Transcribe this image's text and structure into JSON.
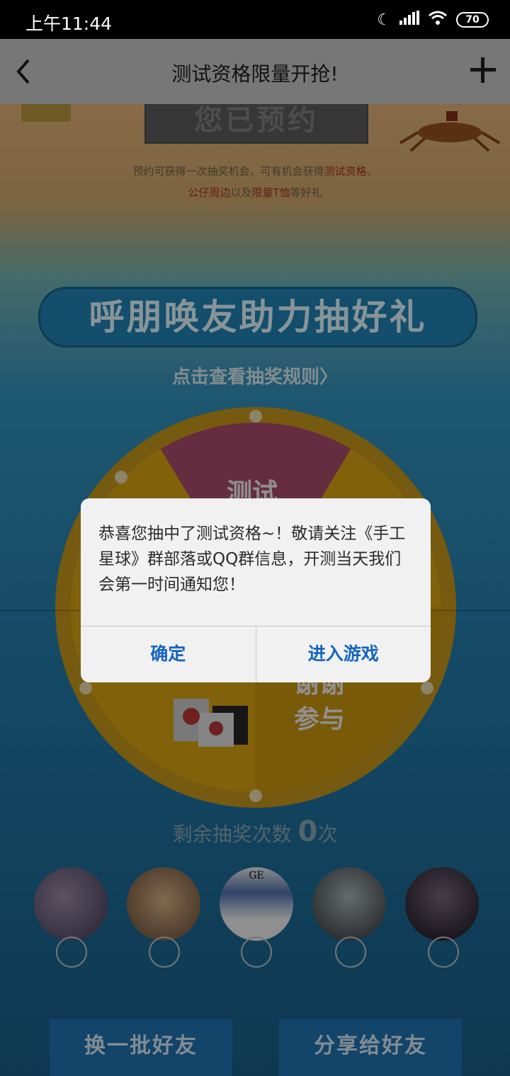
{
  "status": {
    "time": "上午11:44",
    "battery": "70"
  },
  "nav": {
    "title": "测试资格限量开抢!"
  },
  "page": {
    "reserved_label": "您已预约",
    "desc_line1_pre": "预约可获得一次抽奖机会，可有机会获得",
    "desc_line1_hl": "测试资格",
    "desc_line1_post": "、",
    "desc_line2_hl1": "公仔周边",
    "desc_line2_mid": "以及",
    "desc_line2_hl2": "限量T恤",
    "desc_line2_post": "等好礼",
    "banner": "呼朋唤友助力抽好礼",
    "rules_link": "点击查看抽奖规则〉",
    "wheel": {
      "top_segment": "测试",
      "bottom_right_1": "谢谢",
      "bottom_right_2": "参与"
    },
    "remaining_pre": "剩余抽奖次数",
    "remaining_count": "0",
    "remaining_post": "次",
    "friend_avatar_text": "GE",
    "buttons": {
      "refresh": "换一批好友",
      "share": "分享给好友"
    }
  },
  "dialog": {
    "message": "恭喜您抽中了测试资格~！敬请关注《手工星球》群部落或QQ群信息，开测当天我们会第一时间通知您！",
    "confirm": "确定",
    "enter_game": "进入游戏"
  }
}
